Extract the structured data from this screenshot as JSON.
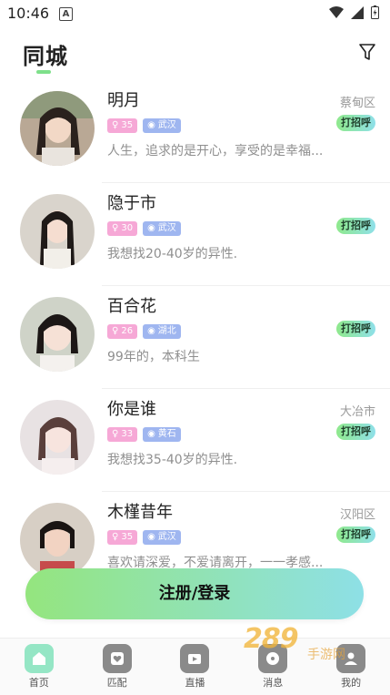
{
  "status": {
    "time": "10:46",
    "notif_icon": "A"
  },
  "header": {
    "title": "同城"
  },
  "users": [
    {
      "name": "明月",
      "age": "35",
      "city": "武汉",
      "bio": "人生，追求的是开心，享受的是幸福...",
      "location": "蔡甸区",
      "greet": "打招呼"
    },
    {
      "name": "隐于市",
      "age": "30",
      "city": "武汉",
      "bio": "我想找20-40岁的异性.",
      "location": "",
      "greet": "打招呼"
    },
    {
      "name": "百合花",
      "age": "26",
      "city": "湖北",
      "bio": "99年的，本科生",
      "location": "",
      "greet": "打招呼"
    },
    {
      "name": "你是谁",
      "age": "33",
      "city": "黄石",
      "bio": "我想找35-40岁的异性.",
      "location": "大冶市",
      "greet": "打招呼"
    },
    {
      "name": "木槿昔年",
      "age": "35",
      "city": "武汉",
      "bio": "喜欢请深爱，不爱请离开，一一孝感...",
      "location": "汉阳区",
      "greet": "打招呼"
    }
  ],
  "login_button": "注册/登录",
  "tabs": [
    {
      "label": "首页",
      "icon": "home-icon",
      "active": true
    },
    {
      "label": "匹配",
      "icon": "heart-card-icon",
      "active": false
    },
    {
      "label": "直播",
      "icon": "live-icon",
      "active": false
    },
    {
      "label": "消息",
      "icon": "message-icon",
      "active": false
    },
    {
      "label": "我的",
      "icon": "profile-icon",
      "active": false
    }
  ],
  "watermark": {
    "text": "289",
    "sub": "手游网"
  },
  "colors": {
    "accent": "#8fe98c",
    "age_tag": "#f6a8d6",
    "loc_tag": "#9fb6f0"
  }
}
